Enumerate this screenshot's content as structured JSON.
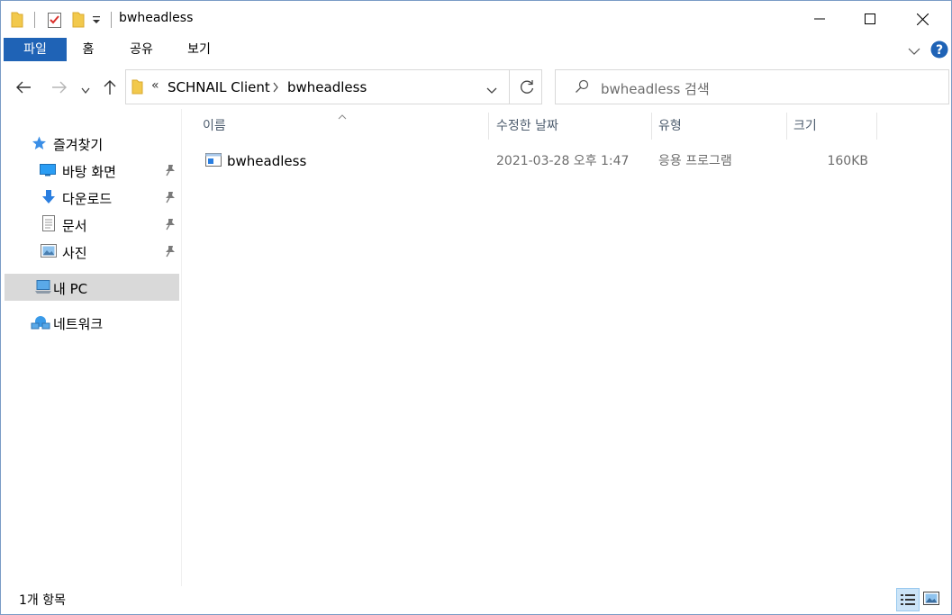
{
  "window": {
    "title": "bwheadless"
  },
  "ribbon": {
    "tabs": [
      "파일",
      "홈",
      "공유",
      "보기"
    ]
  },
  "address": {
    "overflow": "«",
    "crumbs": [
      "SCHNAIL Client",
      "bwheadless"
    ]
  },
  "search": {
    "placeholder": "bwheadless 검색"
  },
  "sidebar": {
    "quick_access": "즐겨찾기",
    "items": [
      {
        "label": "바탕 화면",
        "icon": "desktop-icon"
      },
      {
        "label": "다운로드",
        "icon": "download-icon"
      },
      {
        "label": "문서",
        "icon": "documents-icon"
      },
      {
        "label": "사진",
        "icon": "pictures-icon"
      }
    ],
    "this_pc": "내 PC",
    "network": "네트워크"
  },
  "columns": {
    "name": "이름",
    "date": "수정한 날짜",
    "type": "유형",
    "size": "크기"
  },
  "files": [
    {
      "name": "bwheadless",
      "date": "2021-03-28 오후 1:47",
      "type": "응용 프로그램",
      "size": "160KB",
      "icon": "application-icon"
    }
  ],
  "status": {
    "item_count": "1개 항목"
  },
  "colors": {
    "accent": "#1f63b6",
    "selected": "#d9d9d9",
    "help": "#1f63b6"
  }
}
